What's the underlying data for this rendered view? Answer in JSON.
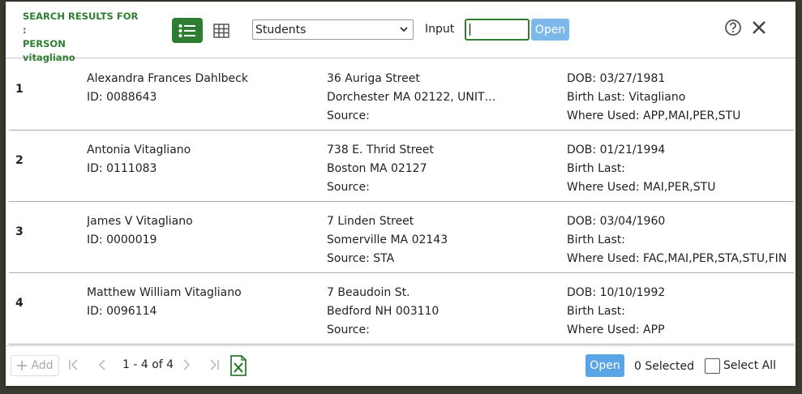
{
  "header": {
    "title_line1": "SEARCH RESULTS FOR :",
    "title_line2": "PERSON",
    "title_line3": "vitagliano",
    "select_value": "Students",
    "input_label": "Input",
    "input_value": "",
    "open_label": "Open"
  },
  "rows": [
    {
      "num": "1",
      "name": "Alexandra Frances Dahlbeck",
      "id": "ID: 0088643",
      "street": "36 Auriga Street",
      "city": "Dorchester MA 02122, UNITED...",
      "source": "Source:",
      "dob": "DOB: 03/27/1981",
      "birth_last": "Birth Last: Vitagliano",
      "where_used": "Where Used: APP,MAI,PER,STU"
    },
    {
      "num": "2",
      "name": "Antonia Vitagliano",
      "id": "ID: 0111083",
      "street": "738 E. Thrid Street",
      "city": "Boston MA 02127",
      "source": "Source:",
      "dob": "DOB: 01/21/1994",
      "birth_last": "Birth Last:",
      "where_used": "Where Used: MAI,PER,STU"
    },
    {
      "num": "3",
      "name": "James V Vitagliano",
      "id": "ID: 0000019",
      "street": "7 Linden Street",
      "city": "Somerville MA 02143",
      "source": "Source: STA",
      "dob": "DOB: 03/04/1960",
      "birth_last": "Birth Last:",
      "where_used": "Where Used: FAC,MAI,PER,STA,STU,FIN"
    },
    {
      "num": "4",
      "name": "Matthew William Vitagliano",
      "id": "ID: 0096114",
      "street": "7 Beaudoin St.",
      "city": "Bedford NH 003110",
      "source": "Source:",
      "dob": "DOB: 10/10/1992",
      "birth_last": "Birth Last:",
      "where_used": "Where Used: APP"
    }
  ],
  "footer": {
    "add_label": "Add",
    "pager": "1 - 4 of 4",
    "open_label": "Open",
    "selected": "0 Selected",
    "select_all": "Select All"
  },
  "colors": {
    "accent": "#2e7d32",
    "open_top": "#7db8ea",
    "open_bottom": "#5aa5e6"
  },
  "icons": [
    "list-view-icon",
    "grid-view-icon",
    "chevron-down-icon",
    "help-icon",
    "close-icon",
    "plus-icon",
    "first-page-icon",
    "prev-page-icon",
    "next-page-icon",
    "last-page-icon",
    "excel-export-icon"
  ]
}
